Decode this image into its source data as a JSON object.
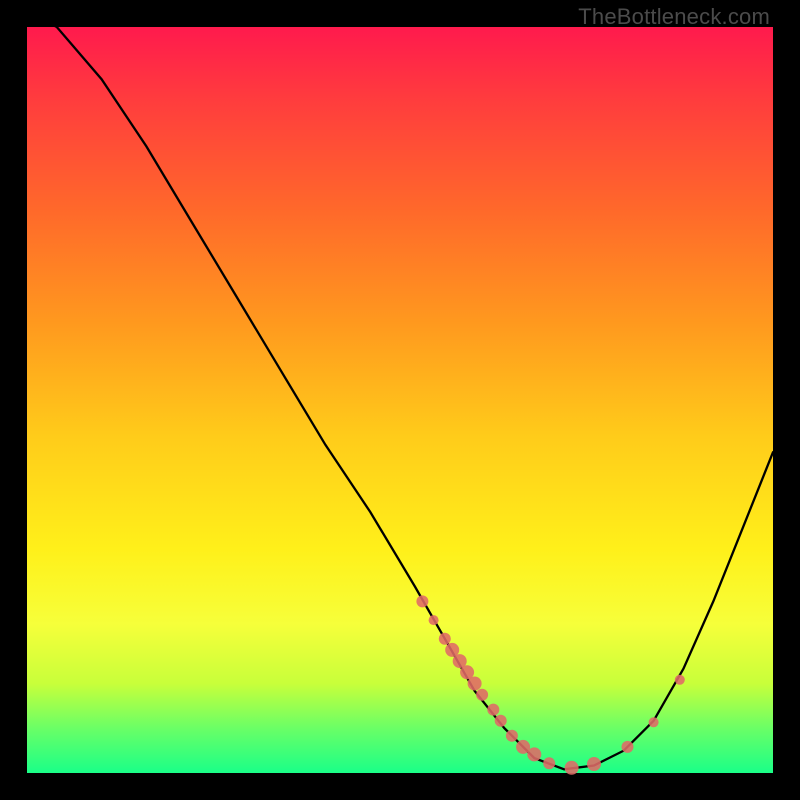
{
  "watermark": "TheBottleneck.com",
  "colors": {
    "curve": "#000000",
    "marker_fill": "#e06a67",
    "marker_stroke": "#b24c49",
    "background": "#000000"
  },
  "chart_data": {
    "type": "line",
    "title": "",
    "xlabel": "",
    "ylabel": "",
    "xlim": [
      0,
      100
    ],
    "ylim": [
      0,
      100
    ],
    "grid": false,
    "legend": false,
    "x_comment": "x as percent of plot width (0 = left edge, 100 = right edge)",
    "y_comment": "y as percent of plot height (0 = bottom, 100 = top). Curve descends to a minimum near x≈72 then rises.",
    "curve": [
      {
        "x": 0,
        "y": 102
      },
      {
        "x": 4,
        "y": 100
      },
      {
        "x": 10,
        "y": 93
      },
      {
        "x": 16,
        "y": 84
      },
      {
        "x": 22,
        "y": 74
      },
      {
        "x": 28,
        "y": 64
      },
      {
        "x": 34,
        "y": 54
      },
      {
        "x": 40,
        "y": 44
      },
      {
        "x": 46,
        "y": 35
      },
      {
        "x": 52,
        "y": 25
      },
      {
        "x": 56,
        "y": 18
      },
      {
        "x": 60,
        "y": 11
      },
      {
        "x": 64,
        "y": 6
      },
      {
        "x": 68,
        "y": 2
      },
      {
        "x": 72,
        "y": 0.5
      },
      {
        "x": 76,
        "y": 1
      },
      {
        "x": 80,
        "y": 3
      },
      {
        "x": 84,
        "y": 7
      },
      {
        "x": 88,
        "y": 14
      },
      {
        "x": 92,
        "y": 23
      },
      {
        "x": 96,
        "y": 33
      },
      {
        "x": 100,
        "y": 43
      }
    ],
    "markers": [
      {
        "x": 53,
        "y": 23,
        "r": 6
      },
      {
        "x": 54.5,
        "y": 20.5,
        "r": 5
      },
      {
        "x": 56,
        "y": 18,
        "r": 6
      },
      {
        "x": 57,
        "y": 16.5,
        "r": 7
      },
      {
        "x": 58,
        "y": 15,
        "r": 7
      },
      {
        "x": 59,
        "y": 13.5,
        "r": 7
      },
      {
        "x": 60,
        "y": 12,
        "r": 7
      },
      {
        "x": 61,
        "y": 10.5,
        "r": 6
      },
      {
        "x": 62.5,
        "y": 8.5,
        "r": 6
      },
      {
        "x": 63.5,
        "y": 7,
        "r": 6
      },
      {
        "x": 65,
        "y": 5,
        "r": 6
      },
      {
        "x": 66.5,
        "y": 3.5,
        "r": 7
      },
      {
        "x": 68,
        "y": 2.5,
        "r": 7
      },
      {
        "x": 70,
        "y": 1.3,
        "r": 6
      },
      {
        "x": 73,
        "y": 0.7,
        "r": 7
      },
      {
        "x": 76,
        "y": 1.2,
        "r": 7
      },
      {
        "x": 80.5,
        "y": 3.5,
        "r": 6
      },
      {
        "x": 84,
        "y": 6.8,
        "r": 5
      },
      {
        "x": 87.5,
        "y": 12.5,
        "r": 5
      }
    ]
  }
}
